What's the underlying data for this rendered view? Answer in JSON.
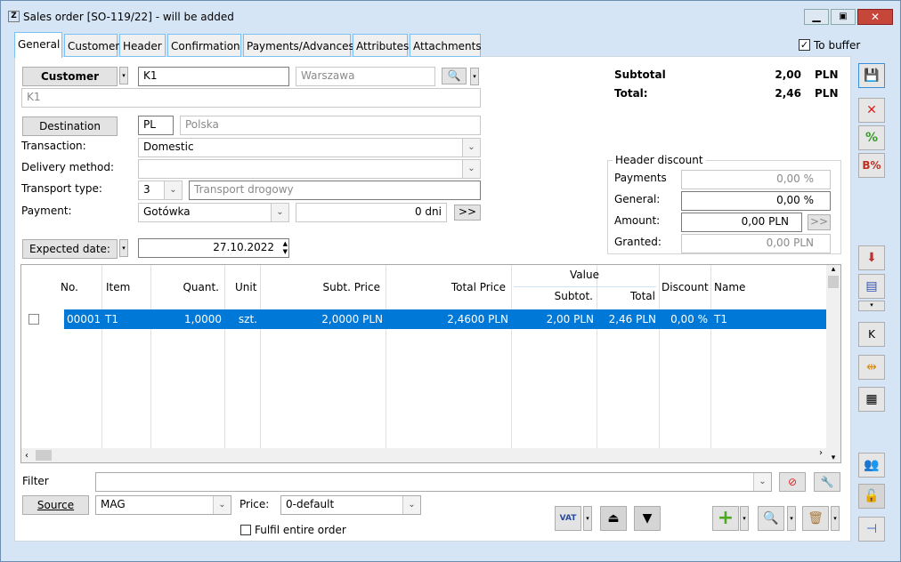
{
  "window": {
    "title": "Sales order [SO-119/22] - will be added"
  },
  "tabs": [
    "General",
    "Customer",
    "Header",
    "Confirmation",
    "Payments/Advances",
    "Attributes",
    "Attachments"
  ],
  "to_buffer": {
    "label": "To buffer",
    "checked": true
  },
  "customer": {
    "button": "Customer",
    "code": "K1",
    "city": "Warszawa",
    "name": "K1"
  },
  "destination": {
    "button": "Destination",
    "code": "PL",
    "country": "Polska"
  },
  "transaction": {
    "label": "Transaction:",
    "value": "Domestic"
  },
  "delivery": {
    "label": "Delivery method:",
    "value": ""
  },
  "transport": {
    "label": "Transport type:",
    "code": "3",
    "value": "Transport drogowy"
  },
  "payment": {
    "label": "Payment:",
    "value": "Gotówka",
    "days": "0 dni",
    "more": ">>"
  },
  "expected": {
    "button": "Expected date:",
    "value": "27.10.2022"
  },
  "totals": {
    "subtotal_label": "Subtotal",
    "subtotal": "2,00",
    "total_label": "Total:",
    "total": "2,46",
    "currency": "PLN"
  },
  "header_discount": {
    "title": "Header discount",
    "payments_label": "Payments",
    "payments": "0,00 %",
    "general_label": "General:",
    "general": "0,00 %",
    "amount_label": "Amount:",
    "amount": "0,00 PLN",
    "more": ">>",
    "granted_label": "Granted:",
    "granted": "0,00 PLN"
  },
  "grid": {
    "headers": {
      "no": "No.",
      "item": "Item",
      "quant": "Quant.",
      "unit": "Unit",
      "subt_price": "Subt. Price",
      "total_price": "Total Price",
      "value": "Value",
      "subtot": "Subtot.",
      "total": "Total",
      "discount": "Discount",
      "name": "Name"
    },
    "rows": [
      {
        "no": "00001",
        "item": "T1",
        "quant": "1,0000",
        "unit": "szt.",
        "subt_price": "2,0000 PLN",
        "total_price": "2,4600 PLN",
        "subtot": "2,00 PLN",
        "total": "2,46 PLN",
        "discount": "0,00 %",
        "name": "T1"
      }
    ]
  },
  "filter": {
    "label": "Filter",
    "value": ""
  },
  "source": {
    "button": "Source",
    "value": "MAG",
    "price_label": "Price:",
    "price": "0-default"
  },
  "fulfil": {
    "label": "Fulfil entire order",
    "checked": false
  },
  "colors": {
    "selection": "#0078d7",
    "accent": "#7cc1f4"
  }
}
